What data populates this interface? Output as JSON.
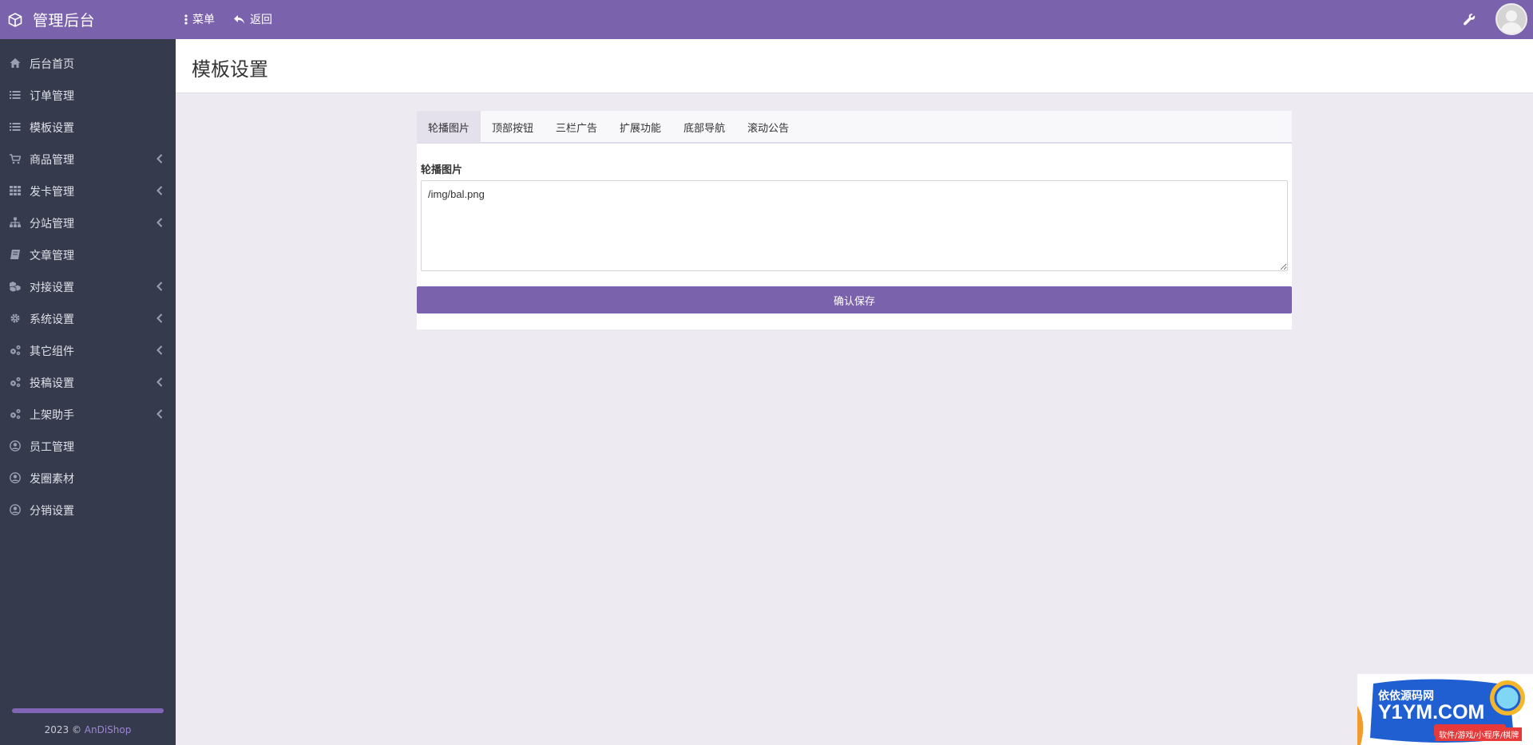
{
  "app": {
    "title": "管理后台"
  },
  "topbar": {
    "menu_label": "菜单",
    "back_label": "返回",
    "accent_color": "#7b62ad"
  },
  "sidebar": {
    "items": [
      {
        "label": "后台首页",
        "icon": "home-icon",
        "has_submenu": false
      },
      {
        "label": "订单管理",
        "icon": "list-icon",
        "has_submenu": false
      },
      {
        "label": "模板设置",
        "icon": "list-icon",
        "has_submenu": false
      },
      {
        "label": "商品管理",
        "icon": "cart-icon",
        "has_submenu": true
      },
      {
        "label": "发卡管理",
        "icon": "grid-icon",
        "has_submenu": true
      },
      {
        "label": "分站管理",
        "icon": "sitemap-icon",
        "has_submenu": true
      },
      {
        "label": "文章管理",
        "icon": "book-icon",
        "has_submenu": false
      },
      {
        "label": "对接设置",
        "icon": "cubes-icon",
        "has_submenu": true
      },
      {
        "label": "系统设置",
        "icon": "gear-icon",
        "has_submenu": true
      },
      {
        "label": "其它组件",
        "icon": "cogs-icon",
        "has_submenu": true
      },
      {
        "label": "投稿设置",
        "icon": "cogs-icon",
        "has_submenu": true
      },
      {
        "label": "上架助手",
        "icon": "cogs-icon",
        "has_submenu": true
      },
      {
        "label": "员工管理",
        "icon": "user-circle-icon",
        "has_submenu": false
      },
      {
        "label": "发圈素材",
        "icon": "user-circle-icon",
        "has_submenu": false
      },
      {
        "label": "分销设置",
        "icon": "user-circle-icon",
        "has_submenu": false
      }
    ],
    "footer_prefix": "2023 ©",
    "footer_link": "AnDiShop"
  },
  "page": {
    "title": "模板设置"
  },
  "panel": {
    "tabs": [
      {
        "label": "轮播图片",
        "active": true
      },
      {
        "label": "顶部按钮",
        "active": false
      },
      {
        "label": "三栏广告",
        "active": false
      },
      {
        "label": "扩展功能",
        "active": false
      },
      {
        "label": "底部导航",
        "active": false
      },
      {
        "label": "滚动公告",
        "active": false
      }
    ],
    "field_label": "轮播图片",
    "field_value": "/img/bal.png",
    "save_label": "确认保存"
  },
  "watermark": {
    "title": "依依源码网",
    "domain": "Y1YM.COM",
    "subtitle": "软件/游戏/小程序/棋牌"
  }
}
